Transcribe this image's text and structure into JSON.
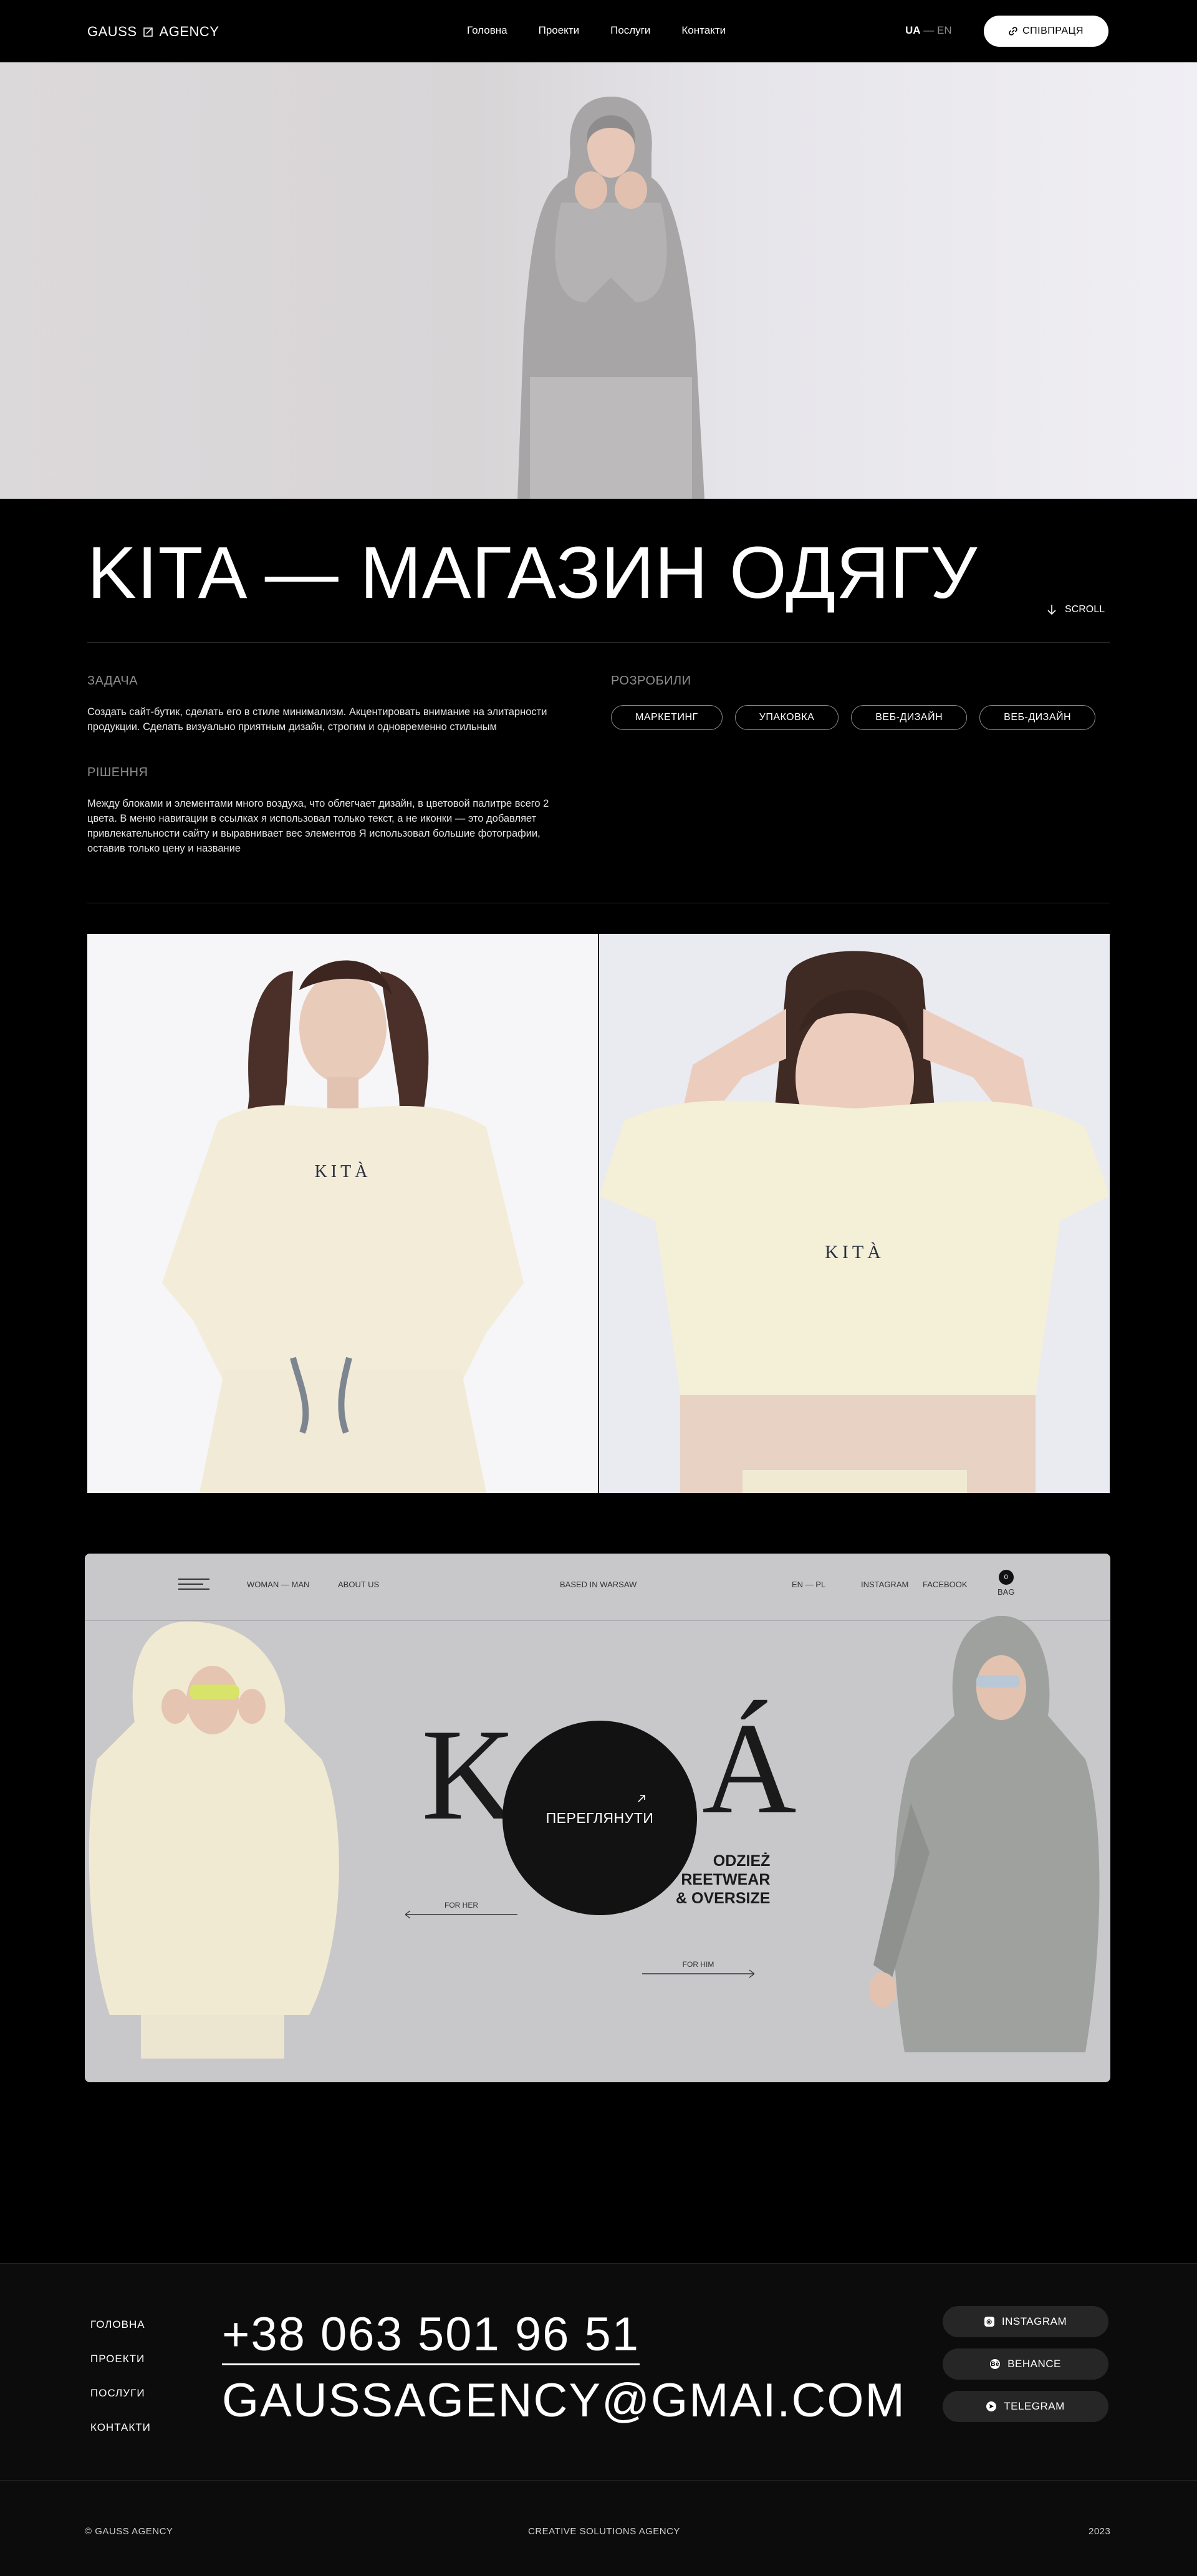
{
  "header": {
    "logo_left": "GAUSS",
    "logo_right": "AGENCY",
    "nav": [
      "Головна",
      "Проекти",
      "Послуги",
      "Контакти"
    ],
    "lang_active": "UA",
    "lang_sep": "—",
    "lang_inactive": "EN",
    "collab_label": "СПІВПРАЦЯ"
  },
  "project": {
    "title": "KITA — МАГАЗИН ОДЯГУ",
    "scroll_label": "SCROLL",
    "task_label": "ЗАДАЧА",
    "task_text": "Создать сайт-бутик, сделать его в стиле минимализм. Акцентировать внимание на элитарности продукции. Сделать визуально приятным дизайн, строгим и одновременно стильным",
    "solution_label": "РІШЕННЯ",
    "solution_text": "Между блоками и элементами много воздуха, что облегчает дизайн, в цветовой палитре всего 2 цвета. В меню навигации в ссылках я использовал только текст, а не иконки — это добавляет привлекательности сайту и выравнивает вес элементов  Я использовал большие фотографии, оставив только цену и название",
    "developed_label": "РОЗРОБИЛИ",
    "tags": [
      "МАРКЕТИНГ",
      "УПАКОВКА",
      "ВЕБ-ДИЗАЙН",
      "ВЕБ-ДИЗАЙН"
    ]
  },
  "gallery": {
    "shirt_print": "KITÀ"
  },
  "mockup": {
    "nav_gender": "WOMAN — MAN",
    "nav_about": "ABOUT US",
    "nav_center": "BASED IN WARSAW",
    "nav_lang": "EN — PL",
    "nav_instagram": "INSTAGRAM",
    "nav_facebook": "FACEBOOK",
    "bag_count": "0",
    "bag_label": "BAG",
    "brand_k": "K",
    "brand_a": "Á",
    "brand_sub_1": "ODZIEŻ",
    "brand_sub_2": "REETWEAR",
    "brand_sub_3": "& OVERSIZE",
    "view_label": "ПЕРЕГЛЯНУТИ",
    "for_her": "FOR HER",
    "for_him": "FOR HIM"
  },
  "footer": {
    "nav": [
      "ГОЛОВНА",
      "ПРОЕКТИ",
      "ПОСЛУГИ",
      "КОНТАКТИ"
    ],
    "phone": "+38 063 501 96 51",
    "email": "GAUSSAGENCY@GMAI.COM",
    "socials": [
      "INSTAGRAM",
      "BEHANCE",
      "TELEGRAM"
    ],
    "copyright": "© GAUSS AGENCY",
    "tagline": "CREATIVE SOLUTIONS AGENCY",
    "year": "2023"
  }
}
